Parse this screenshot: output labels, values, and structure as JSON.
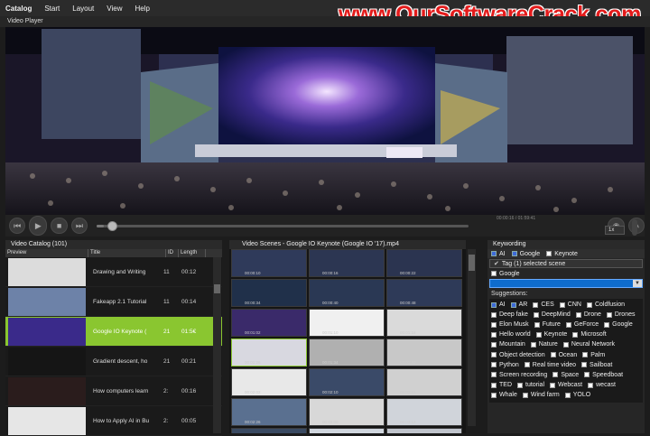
{
  "menubar": {
    "items": [
      "Catalog",
      "Start",
      "Layout",
      "View",
      "Help"
    ]
  },
  "watermark": "www.OurSoftwareCrack.com",
  "video_player": {
    "title": "Video Player",
    "time": "00:00:16 / 01:59:41",
    "rate": "1x"
  },
  "catalog": {
    "title": "Video Catalog (101)",
    "columns": [
      "Preview",
      "Title",
      "ID",
      "Length"
    ],
    "rows": [
      {
        "title": "Drawing and Writing",
        "id": "11",
        "length": "00:12",
        "selected": false
      },
      {
        "title": "Fakeapp 2.1 Tutorial",
        "id": "11",
        "length": "00:14",
        "selected": false
      },
      {
        "title": "Google IO Keynote (",
        "id": "21",
        "length": "01:5€",
        "selected": true
      },
      {
        "title": "Gradient descent, ho",
        "id": "21",
        "length": "00:21",
        "selected": false
      },
      {
        "title": "How computers learn",
        "id": "2:",
        "length": "00:16",
        "selected": false
      },
      {
        "title": "How to Apply AI in Bu",
        "id": "2:",
        "length": "00:05",
        "selected": false
      }
    ]
  },
  "scenes": {
    "title": "Video Scenes - Google IO Keynote (Google IO '17).mp4",
    "items": [
      {
        "ts": "00:00:10"
      },
      {
        "ts": "00:00:16"
      },
      {
        "ts": "00:00:22"
      },
      {
        "ts": "00:00:34"
      },
      {
        "ts": "00:00:40"
      },
      {
        "ts": "00:00:48"
      },
      {
        "ts": "00:01:02"
      },
      {
        "ts": "00:01:10"
      },
      {
        "ts": "00:01:18"
      },
      {
        "ts": "00:01:26"
      },
      {
        "ts": "00:01:34"
      },
      {
        "ts": "00:01:42"
      },
      {
        "ts": "00:02:02"
      },
      {
        "ts": "00:02:10"
      },
      {
        "ts": "00:02:18"
      },
      {
        "ts": "00:02:26"
      },
      {
        "ts": "00:03:00"
      },
      {
        "ts": "00:03:12"
      },
      {
        "ts": "00:03:20"
      },
      {
        "ts": "00:03:30"
      },
      {
        "ts": "00:03:40"
      }
    ]
  },
  "keywording": {
    "title": "Keywording",
    "top_tags": [
      "AI",
      "Google",
      "Keynote"
    ],
    "tag_label": "Tag (1) selected scene",
    "current": "Google",
    "suggestions_label": "Suggestions:",
    "suggestions": [
      {
        "label": "AI",
        "on": true
      },
      {
        "label": "AR",
        "on": true
      },
      {
        "label": "CES",
        "on": false
      },
      {
        "label": "CNN",
        "on": false
      },
      {
        "label": "Coldfusion",
        "on": false
      },
      {
        "label": "Deep fake",
        "on": false
      },
      {
        "label": "DeepMind",
        "on": false
      },
      {
        "label": "Drone",
        "on": false
      },
      {
        "label": "Drones",
        "on": false
      },
      {
        "label": "Elon Musk",
        "on": false
      },
      {
        "label": "Future",
        "on": false
      },
      {
        "label": "GeForce",
        "on": false
      },
      {
        "label": "Google",
        "on": false
      },
      {
        "label": "Hello world",
        "on": false
      },
      {
        "label": "Keynote",
        "on": false
      },
      {
        "label": "Microsoft",
        "on": false
      },
      {
        "label": "Mountain",
        "on": false
      },
      {
        "label": "Nature",
        "on": false
      },
      {
        "label": "Neural Network",
        "on": false
      },
      {
        "label": "Object detection",
        "on": false
      },
      {
        "label": "Ocean",
        "on": false
      },
      {
        "label": "Palm",
        "on": false
      },
      {
        "label": "Python",
        "on": false
      },
      {
        "label": "Real time video",
        "on": false
      },
      {
        "label": "Sailboat",
        "on": false
      },
      {
        "label": "Screen recording",
        "on": false
      },
      {
        "label": "Space",
        "on": false
      },
      {
        "label": "Speedboat",
        "on": false
      },
      {
        "label": "TED",
        "on": false
      },
      {
        "label": "tutorial",
        "on": false
      },
      {
        "label": "Webcast",
        "on": false
      },
      {
        "label": "wecast",
        "on": false
      },
      {
        "label": "Whale",
        "on": false
      },
      {
        "label": "Wind farm",
        "on": false
      },
      {
        "label": "YOLO",
        "on": false
      }
    ]
  },
  "colors": {
    "accent_green": "#8ac630",
    "select_blue": "#0e6ccd"
  },
  "playback_progress": 0.02
}
